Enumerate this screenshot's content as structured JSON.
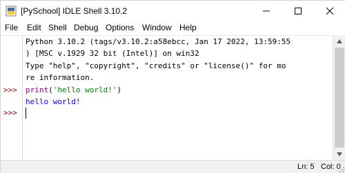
{
  "window": {
    "title": "[PySchool] IDLE Shell 3.10.2"
  },
  "window_controls": {
    "minimize_icon": "minimize-icon",
    "maximize_icon": "maximize-icon",
    "close_icon": "close-icon"
  },
  "menu": {
    "items": [
      "File",
      "Edit",
      "Shell",
      "Debug",
      "Options",
      "Window",
      "Help"
    ]
  },
  "shell": {
    "banner_line1": "Python 3.10.2 (tags/v3.10.2:a58ebcc, Jan 17 2022, 13:59:55",
    "banner_line2": ") [MSC v.1929 32 bit (Intel)] on win32",
    "banner_line3": "Type \"help\", \"copyright\", \"credits\" or \"license()\" for mo",
    "banner_line4": "re information.",
    "prompt": ">>>",
    "command_fn": "print",
    "command_open": "(",
    "command_str": "'hello world!'",
    "command_close": ")",
    "output": "hello world!"
  },
  "status": {
    "line": "Ln: 5",
    "col": "Col: 0"
  },
  "colors": {
    "prompt": "#8b0000",
    "string": "#008000",
    "builtin": "#900090",
    "output": "#0000ff"
  }
}
